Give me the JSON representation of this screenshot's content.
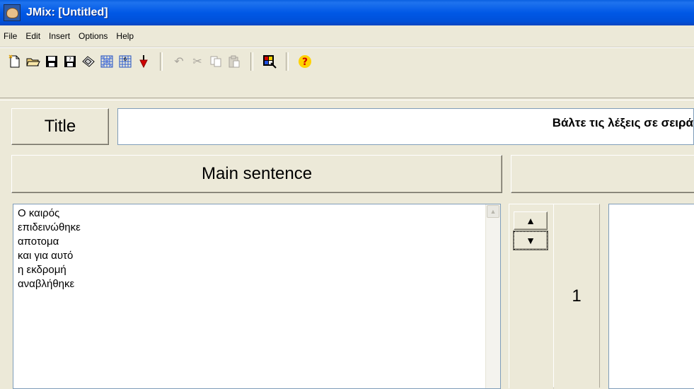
{
  "window": {
    "title": "JMix: [Untitled]"
  },
  "menu": {
    "items": [
      "File",
      "Edit",
      "Insert",
      "Options",
      "Help"
    ]
  },
  "toolbar": {
    "buttons": [
      {
        "name": "new-file-icon",
        "glyph": "🗋"
      },
      {
        "name": "open-folder-icon",
        "glyph": "📂"
      },
      {
        "name": "save-icon",
        "glyph": "💾"
      },
      {
        "name": "save-as-icon",
        "glyph": "💾"
      },
      {
        "name": "eraser-icon",
        "glyph": "◇"
      },
      {
        "name": "create-web-page-icon",
        "glyph": "▦"
      },
      {
        "name": "create-web-page-alt-icon",
        "glyph": "▦"
      },
      {
        "name": "export-arrow-icon",
        "glyph": "🡇"
      },
      {
        "name": "undo-icon",
        "glyph": "↶"
      },
      {
        "name": "cut-icon",
        "glyph": "✂"
      },
      {
        "name": "copy-icon",
        "glyph": "⎘"
      },
      {
        "name": "paste-icon",
        "glyph": "📋"
      },
      {
        "name": "configure-icon",
        "glyph": "▣"
      },
      {
        "name": "help-icon",
        "glyph": "?"
      }
    ]
  },
  "title_row": {
    "label": "Title",
    "value": "Βάλτε τις λέξεις σε σειρά"
  },
  "main": {
    "label": "Main sentence",
    "lines": [
      "Ο καιρός",
      "επιδεινώθηκε",
      "αποτομα",
      "και για αυτό",
      "η εκδρομή",
      "αναβλήθηκε"
    ]
  },
  "alternate": {
    "number": "1"
  },
  "colors": {
    "titlebar": "#0058e6",
    "face": "#ece9d8",
    "help_icon": "#ffd200"
  }
}
